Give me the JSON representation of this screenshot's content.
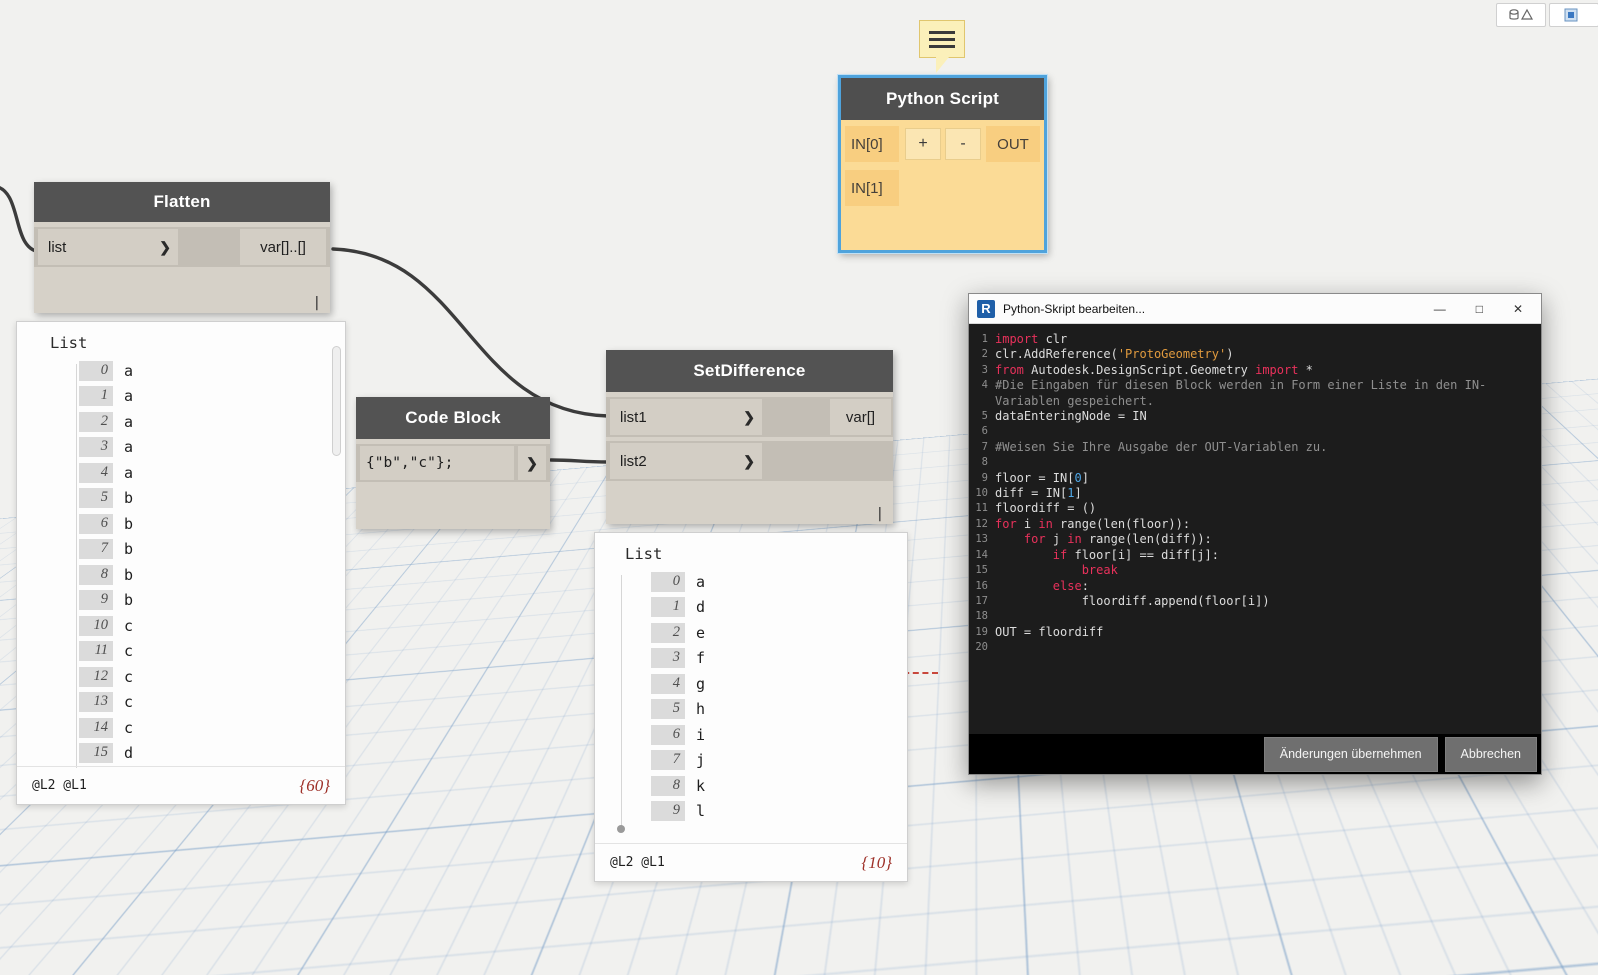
{
  "window_controls": {
    "minimize": "—",
    "maximize": "□",
    "close": "✕"
  },
  "toolbar": {
    "icons": [
      "geometry-preview-icon",
      "graph-view-icon"
    ]
  },
  "nodes": {
    "flatten": {
      "title": "Flatten",
      "input_label": "list",
      "output_label": "var[]..[]",
      "lacing": "|",
      "chevron": "❯"
    },
    "code_block": {
      "title": "Code Block",
      "code": "{\"b\",\"c\"};",
      "chevron": "❯"
    },
    "set_difference": {
      "title": "SetDifference",
      "input1_label": "list1",
      "input2_label": "list2",
      "output_label": "var[]",
      "lacing": "|",
      "chevron": "❯"
    },
    "python_script": {
      "title": "Python Script",
      "input1_label": "IN[0]",
      "input2_label": "IN[1]",
      "add_label": "+",
      "remove_label": "-",
      "output_label": "OUT"
    }
  },
  "previews": {
    "flatten_list": {
      "header": "List",
      "levels": "@L2 @L1",
      "count": "{60}",
      "items": [
        {
          "i": "0",
          "v": "a"
        },
        {
          "i": "1",
          "v": "a"
        },
        {
          "i": "2",
          "v": "a"
        },
        {
          "i": "3",
          "v": "a"
        },
        {
          "i": "4",
          "v": "a"
        },
        {
          "i": "5",
          "v": "b"
        },
        {
          "i": "6",
          "v": "b"
        },
        {
          "i": "7",
          "v": "b"
        },
        {
          "i": "8",
          "v": "b"
        },
        {
          "i": "9",
          "v": "b"
        },
        {
          "i": "10",
          "v": "c"
        },
        {
          "i": "11",
          "v": "c"
        },
        {
          "i": "12",
          "v": "c"
        },
        {
          "i": "13",
          "v": "c"
        },
        {
          "i": "14",
          "v": "c"
        },
        {
          "i": "15",
          "v": "d"
        }
      ]
    },
    "diff_list": {
      "header": "List",
      "levels": "@L2 @L1",
      "count": "{10}",
      "items": [
        {
          "i": "0",
          "v": "a"
        },
        {
          "i": "1",
          "v": "d"
        },
        {
          "i": "2",
          "v": "e"
        },
        {
          "i": "3",
          "v": "f"
        },
        {
          "i": "4",
          "v": "g"
        },
        {
          "i": "5",
          "v": "h"
        },
        {
          "i": "6",
          "v": "i"
        },
        {
          "i": "7",
          "v": "j"
        },
        {
          "i": "8",
          "v": "k"
        },
        {
          "i": "9",
          "v": "l"
        }
      ]
    }
  },
  "editor": {
    "title": "Python-Skript bearbeiten...",
    "apply_label": "Änderungen übernehmen",
    "cancel_label": "Abbrechen",
    "code": [
      {
        "n": "1",
        "t": [
          [
            "k",
            "import"
          ],
          [
            "p",
            " clr"
          ]
        ]
      },
      {
        "n": "2",
        "t": [
          [
            "p",
            "clr.AddReference("
          ],
          [
            "s",
            "'ProtoGeometry'"
          ],
          [
            "p",
            ")"
          ]
        ]
      },
      {
        "n": "3",
        "t": [
          [
            "k",
            "from"
          ],
          [
            "p",
            " Autodesk.DesignScript.Geometry "
          ],
          [
            "k",
            "import"
          ],
          [
            "p",
            " *"
          ]
        ]
      },
      {
        "n": "4",
        "t": [
          [
            "c",
            "#Die Eingaben für diesen Block werden in Form einer Liste in den IN-\nVariablen gespeichert."
          ]
        ]
      },
      {
        "n": "5",
        "t": [
          [
            "p",
            "dataEnteringNode = IN"
          ]
        ]
      },
      {
        "n": "6",
        "t": []
      },
      {
        "n": "7",
        "t": [
          [
            "c",
            "#Weisen Sie Ihre Ausgabe der OUT-Variablen zu."
          ]
        ]
      },
      {
        "n": "8",
        "t": []
      },
      {
        "n": "9",
        "t": [
          [
            "p",
            "floor = IN["
          ],
          [
            "n",
            "0"
          ],
          [
            "p",
            "]"
          ]
        ]
      },
      {
        "n": "10",
        "t": [
          [
            "p",
            "diff = IN["
          ],
          [
            "n",
            "1"
          ],
          [
            "p",
            "]"
          ]
        ]
      },
      {
        "n": "11",
        "t": [
          [
            "p",
            "floordiff = ()"
          ]
        ]
      },
      {
        "n": "12",
        "t": [
          [
            "k",
            "for"
          ],
          [
            "p",
            " i "
          ],
          [
            "k",
            "in"
          ],
          [
            "p",
            " range(len(floor)):"
          ]
        ]
      },
      {
        "n": "13",
        "t": [
          [
            "p",
            "    "
          ],
          [
            "k",
            "for"
          ],
          [
            "p",
            " j "
          ],
          [
            "k",
            "in"
          ],
          [
            "p",
            " range(len(diff)):"
          ]
        ]
      },
      {
        "n": "14",
        "t": [
          [
            "p",
            "        "
          ],
          [
            "k",
            "if"
          ],
          [
            "p",
            " floor[i] == diff[j]:"
          ]
        ]
      },
      {
        "n": "15",
        "t": [
          [
            "p",
            "            "
          ],
          [
            "k",
            "break"
          ]
        ]
      },
      {
        "n": "16",
        "t": [
          [
            "p",
            "        "
          ],
          [
            "k",
            "else"
          ],
          [
            "p",
            ":"
          ]
        ]
      },
      {
        "n": "17",
        "t": [
          [
            "p",
            "            floordiff.append(floor[i])"
          ]
        ]
      },
      {
        "n": "18",
        "t": []
      },
      {
        "n": "19",
        "t": [
          [
            "p",
            "OUT = floordiff"
          ]
        ]
      },
      {
        "n": "20",
        "t": []
      }
    ]
  }
}
